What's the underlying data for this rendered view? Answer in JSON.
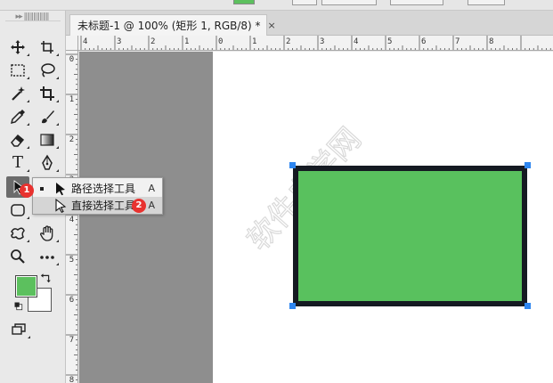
{
  "document": {
    "tab_title": "未标题-1 @ 100% (矩形 1, RGB/8) *",
    "close_glyph": "×"
  },
  "ruler": {
    "top_labels": [
      "4",
      "3",
      "2",
      "1",
      "0",
      "1",
      "2",
      "3",
      "4",
      "5",
      "6",
      "7",
      "8"
    ],
    "left_labels": [
      "0",
      "1",
      "2",
      "3",
      "4",
      "5",
      "6",
      "7",
      "8"
    ]
  },
  "tools": [
    {
      "id": "move",
      "icon": "move-icon"
    },
    {
      "id": "artboard",
      "icon": "artboard-icon"
    },
    {
      "id": "marquee",
      "icon": "rectangle-marquee-icon"
    },
    {
      "id": "lasso",
      "icon": "lasso-icon"
    },
    {
      "id": "magic-wand",
      "icon": "magic-wand-icon"
    },
    {
      "id": "crop",
      "icon": "crop-icon"
    },
    {
      "id": "eyedropper",
      "icon": "eyedropper-icon"
    },
    {
      "id": "brush",
      "icon": "brush-icon"
    },
    {
      "id": "eraser",
      "icon": "eraser-icon"
    },
    {
      "id": "gradient",
      "icon": "gradient-icon"
    },
    {
      "id": "type",
      "icon": "type-icon"
    },
    {
      "id": "pen",
      "icon": "pen-icon"
    },
    {
      "id": "path-select",
      "icon": "path-selection-icon",
      "active": true
    },
    {
      "id": "shape",
      "icon": "rounded-rectangle-icon"
    },
    {
      "id": "custom-shape",
      "icon": "custom-shape-icon"
    },
    {
      "id": "hand",
      "icon": "hand-icon"
    },
    {
      "id": "zoom",
      "icon": "zoom-icon"
    },
    {
      "id": "more",
      "icon": "more-icon"
    },
    {
      "id": "screen-mode",
      "icon": "screen-mode-icon"
    }
  ],
  "colors": {
    "foreground": "#5cc05e",
    "background": "#ffffff",
    "shape_fill": "#59c15e",
    "shape_stroke": "#151a22",
    "handle": "#2e86f0",
    "badge": "#e8322f"
  },
  "type_tool_glyph": "T",
  "flyout": {
    "items": [
      {
        "label": "路径选择工具",
        "shortcut": "A",
        "icon": "path-selection-arrow-icon",
        "current": true
      },
      {
        "label": "直接选择工具",
        "shortcut": "A",
        "icon": "direct-selection-arrow-icon",
        "selected": true
      }
    ]
  },
  "annotations": {
    "badge_1": "1",
    "badge_2": "2"
  },
  "watermark": {
    "text": "软件自学网",
    "subtext": "WWW.RJZXW.COM"
  }
}
